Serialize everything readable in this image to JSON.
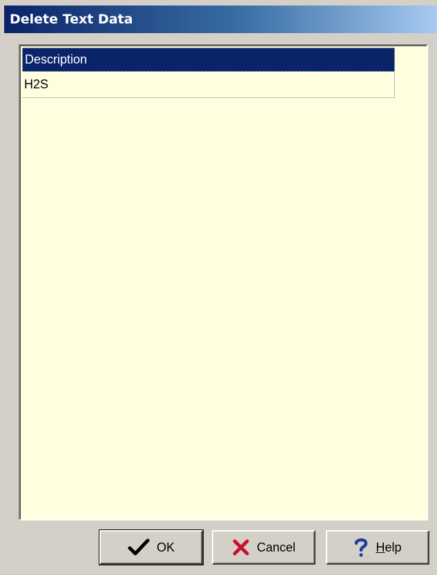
{
  "window": {
    "title": "Delete Text Data"
  },
  "grid": {
    "columns": [
      "Description"
    ],
    "rows": [
      [
        "H2S"
      ]
    ]
  },
  "buttons": {
    "ok": {
      "label": "OK",
      "icon": "checkmark-icon"
    },
    "cancel": {
      "label": "Cancel",
      "icon": "x-cross-icon"
    },
    "help": {
      "label_underlined": "H",
      "label_rest": "elp",
      "icon": "question-mark-icon"
    }
  },
  "colors": {
    "title_gradient_start": "#0a246a",
    "title_gradient_end": "#a6caf0",
    "grid_background": "#ffffe0",
    "selected_header": "#0a246a",
    "dialog_face": "#d4d0c8",
    "ok_check": "#000000",
    "cancel_x": "#c8102e",
    "help_q": "#1f3f9f"
  }
}
